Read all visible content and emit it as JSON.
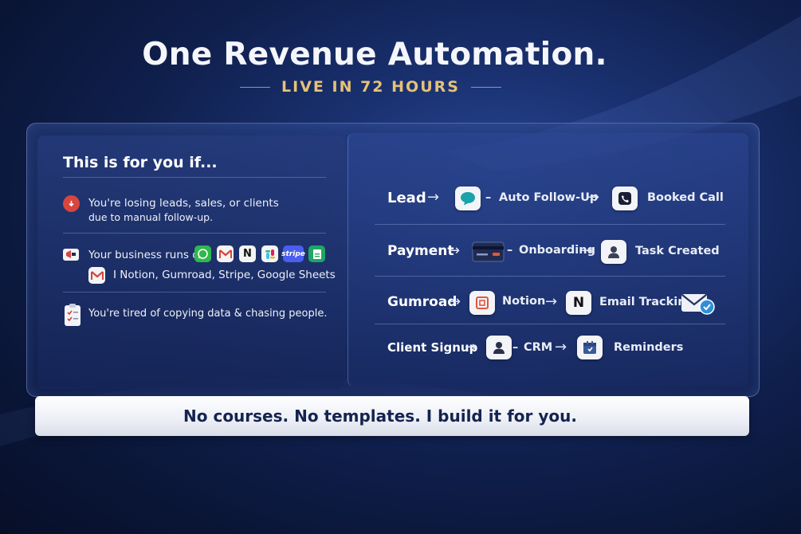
{
  "header": {
    "title": "One Revenue Automation.",
    "subtitle": "LIVE IN 72 HOURS"
  },
  "left": {
    "heading": "This is for you if...",
    "items": [
      {
        "icon": "alert-icon",
        "text_line1": "You're losing leads, sales, or clients",
        "text_line2": "due to manual follow-up."
      },
      {
        "icon": "megaphone-icon",
        "text_line1": "Your business runs on",
        "text_line2": "I Notion, Gumroad, Stripe, Google Sheets"
      },
      {
        "icon": "clipboard-icon",
        "text_line1": "You're tired of copying data & chasing people."
      }
    ],
    "apps": [
      "whatsapp-icon",
      "gmail-icon",
      "notion-icon",
      "slack-icon",
      "stripe-icon",
      "google-sheets-icon"
    ],
    "stripe_label": "stripe"
  },
  "flows": [
    {
      "trigger": "Lead",
      "step": "Auto Follow-Up",
      "result": "Booked Call",
      "icons": [
        "chat-icon",
        "phone-icon"
      ]
    },
    {
      "trigger": "Payment",
      "step": "Onboarding",
      "result": "Task Created",
      "icons": [
        "credit-card-icon",
        "user-icon"
      ]
    },
    {
      "trigger": "Gumroad",
      "step": "Notion",
      "result": "Email Tracking",
      "icons": [
        "gumroad-icon",
        "notion-icon",
        "email-check-icon"
      ]
    },
    {
      "trigger": "Client Signup",
      "step": "CRM",
      "result": "Reminders",
      "icons": [
        "user-icon",
        "calendar-icon"
      ]
    }
  ],
  "banner": "No courses. No templates. I build it for you.",
  "colors": {
    "accent_gold": "#e5c27a",
    "background": "#0f1f4c",
    "alert_red": "#d8453e"
  }
}
